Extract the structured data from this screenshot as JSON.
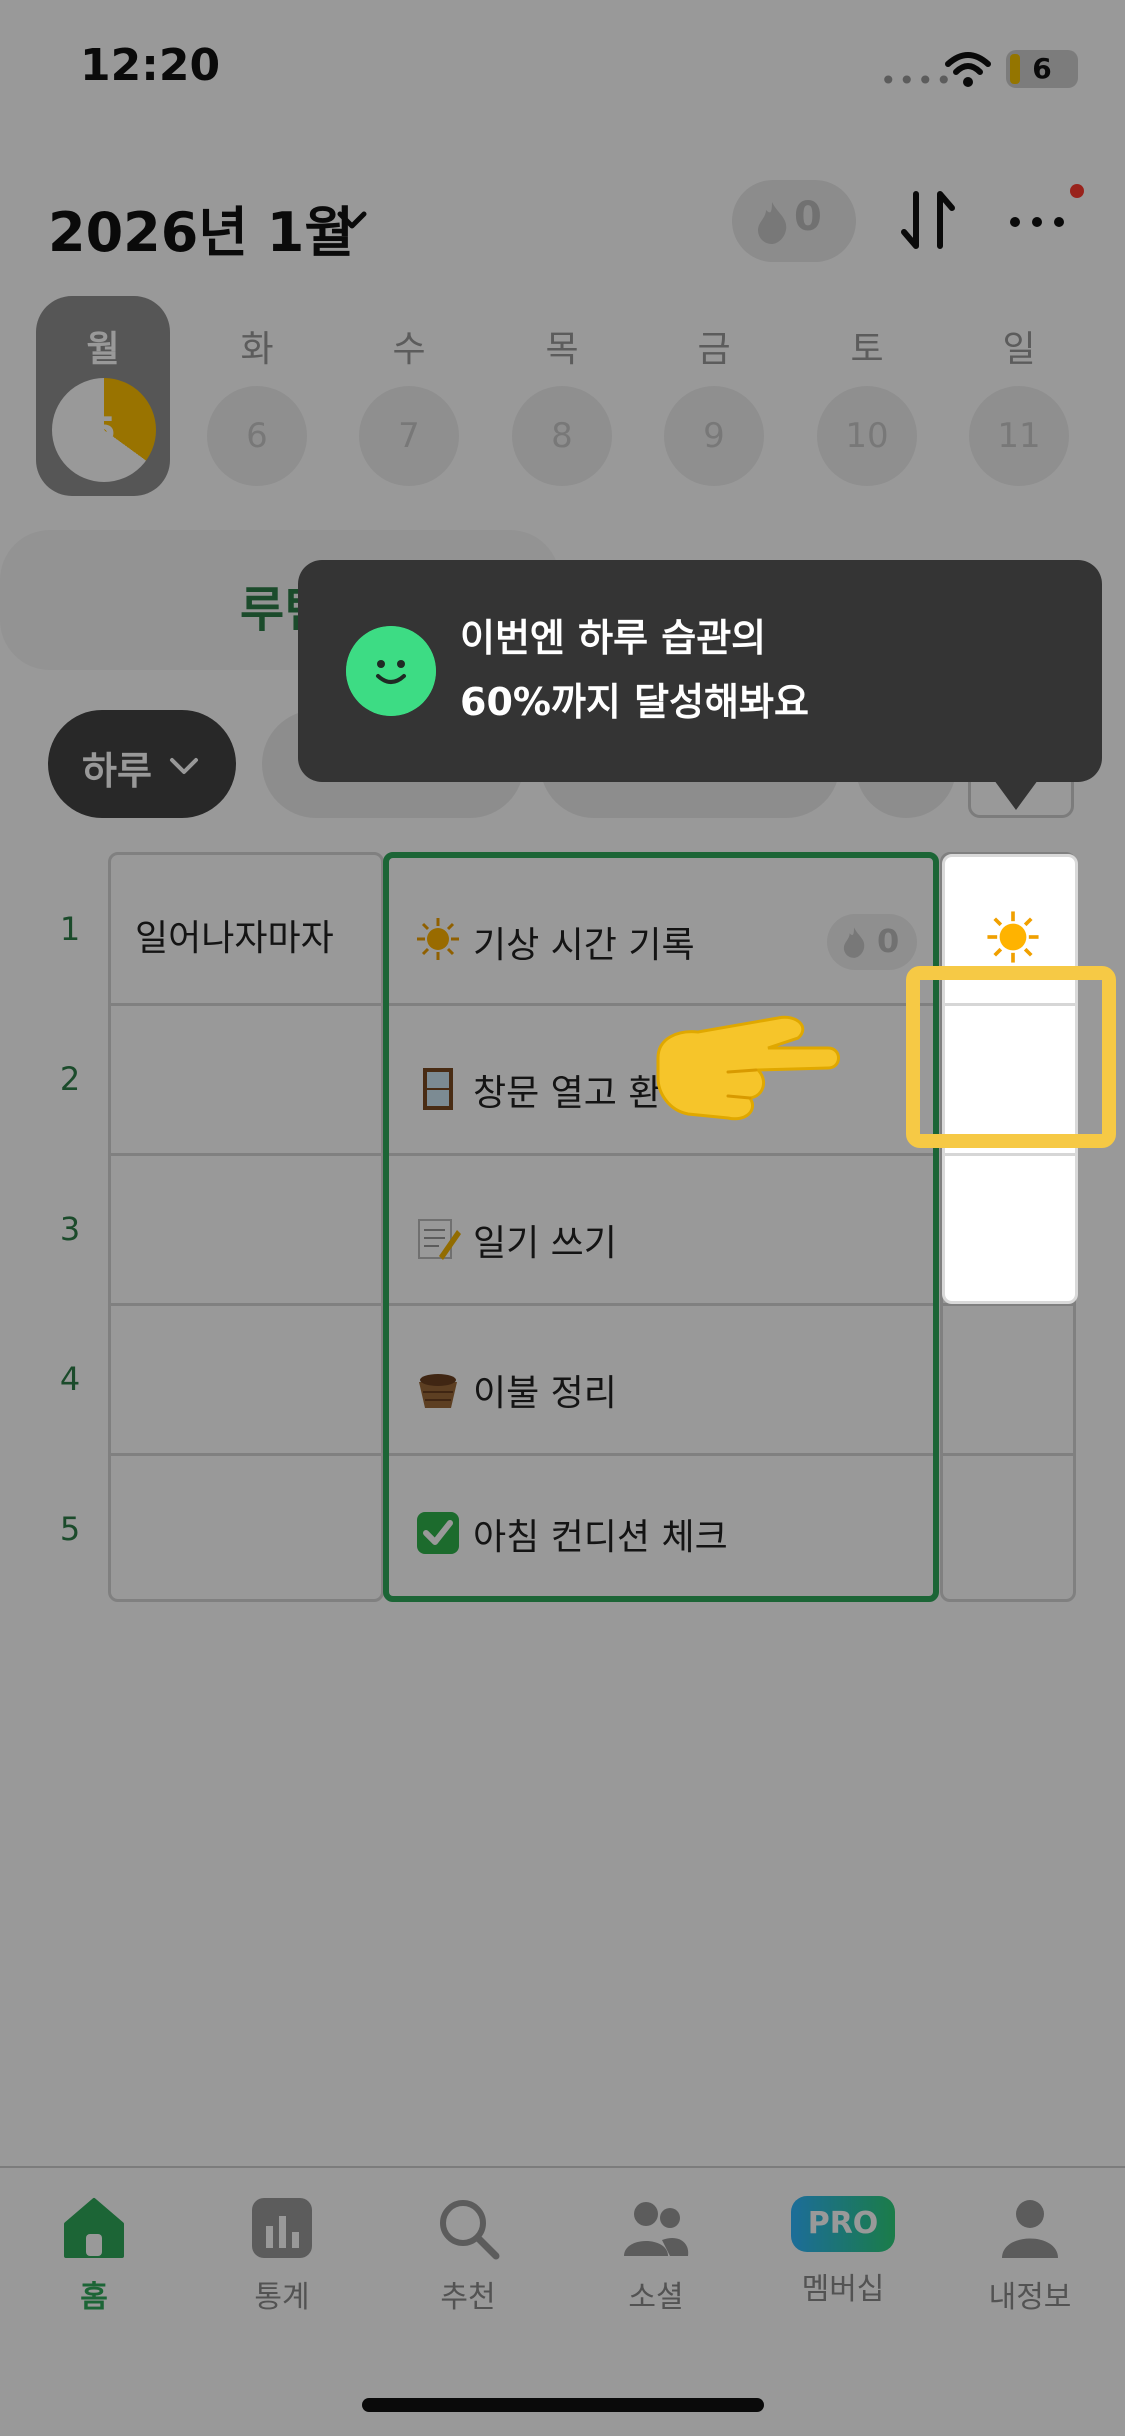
{
  "status_bar": {
    "time": "12:20",
    "battery": "6"
  },
  "header": {
    "month_title": "2026년 1월",
    "streak_count": "0"
  },
  "week": [
    {
      "label": "월",
      "num": "5",
      "selected": true,
      "progress": 0.35
    },
    {
      "label": "화",
      "num": "6"
    },
    {
      "label": "수",
      "num": "7"
    },
    {
      "label": "목",
      "num": "8"
    },
    {
      "label": "금",
      "num": "9"
    },
    {
      "label": "토",
      "num": "10"
    },
    {
      "label": "일",
      "num": "11"
    }
  ],
  "section": {
    "title": "루틴"
  },
  "filter": {
    "label": "하루"
  },
  "tooltip": {
    "line1": "이번엔 하루 습관의",
    "line2": "60%까지 달성해봐요"
  },
  "table": {
    "rows": [
      {
        "num": "1",
        "group": "일어나자마자",
        "habit": "기상 시간 기록",
        "icon": "sun-icon",
        "streak": "0"
      },
      {
        "num": "2",
        "group": "",
        "habit": "창문 열고 환",
        "icon": "door-icon"
      },
      {
        "num": "3",
        "group": "",
        "habit": "일기 쓰기",
        "icon": "memo-icon"
      },
      {
        "num": "4",
        "group": "",
        "habit": "이불 정리",
        "icon": "basket-icon"
      },
      {
        "num": "5",
        "group": "",
        "habit": "아침 컨디션 체크",
        "icon": "check-icon"
      }
    ]
  },
  "nav": [
    {
      "label": "홈",
      "icon": "home-icon",
      "active": true
    },
    {
      "label": "통계",
      "icon": "stats-icon"
    },
    {
      "label": "추천",
      "icon": "search-icon"
    },
    {
      "label": "소셜",
      "icon": "people-icon"
    },
    {
      "label": "멤버십",
      "icon": "pro-badge-icon",
      "badge": "PRO"
    },
    {
      "label": "내정보",
      "icon": "person-icon"
    }
  ],
  "colors": {
    "accent": "#2fa85a",
    "highlight": "#f6c945",
    "progress": "#ffc000",
    "tooltip_bg": "#343434",
    "face": "#3ddc84"
  }
}
